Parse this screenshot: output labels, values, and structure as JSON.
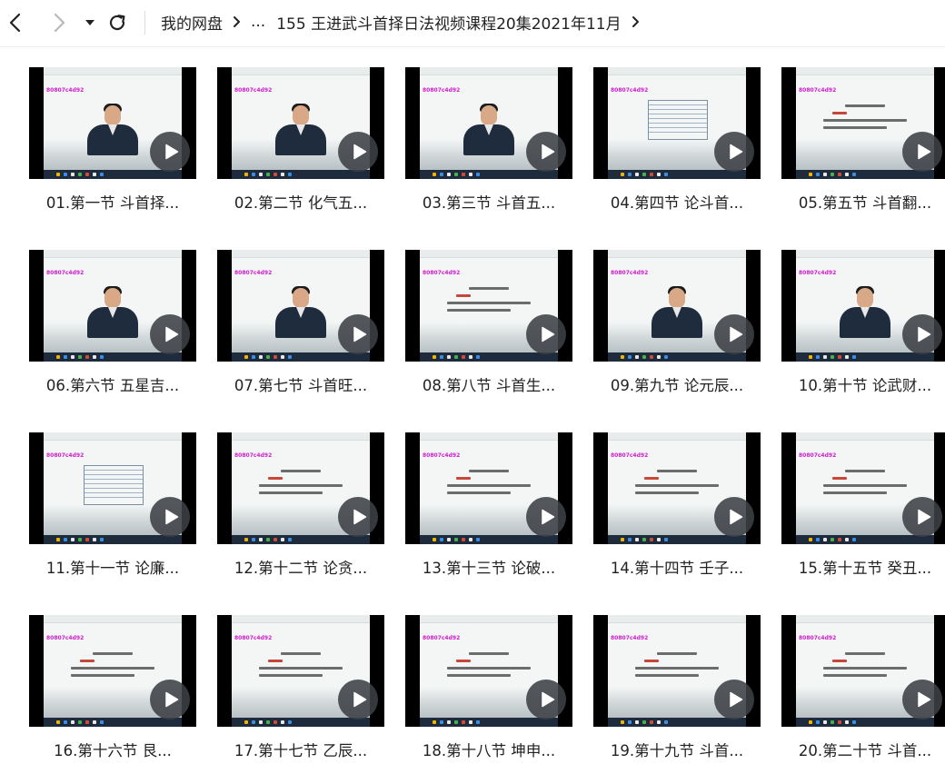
{
  "toolbar": {
    "icons": [
      "back-arrow-icon",
      "forward-arrow-icon",
      "dropdown-triangle-icon",
      "refresh-icon"
    ],
    "breadcrumb": [
      "我的网盘",
      "...",
      "155 王进武斗首择日法视频课程20集2021年11月"
    ]
  },
  "videos": [
    {
      "label": "01.第一节 斗首择...",
      "kind": "person",
      "watermark": "80807c4d92"
    },
    {
      "label": "02.第二节 化气五...",
      "kind": "person",
      "watermark": "80807c4d92"
    },
    {
      "label": "03.第三节 斗首五...",
      "kind": "person",
      "watermark": "80807c4d92"
    },
    {
      "label": "04.第四节 论斗首...",
      "kind": "table",
      "watermark": "80807c4d92"
    },
    {
      "label": "05.第五节 斗首翻...",
      "kind": "slide",
      "watermark": "80807c4d92"
    },
    {
      "label": "06.第六节 五星吉...",
      "kind": "person",
      "watermark": "80807c4d92"
    },
    {
      "label": "07.第七节 斗首旺...",
      "kind": "person",
      "watermark": "80807c4d92"
    },
    {
      "label": "08.第八节 斗首生...",
      "kind": "slide",
      "watermark": "80807c4d92"
    },
    {
      "label": "09.第九节 论元辰...",
      "kind": "person",
      "watermark": "80807c4d92"
    },
    {
      "label": "10.第十节 论武财...",
      "kind": "person",
      "watermark": "80807c4d92"
    },
    {
      "label": "11.第十一节 论廉...",
      "kind": "table",
      "watermark": "80807c4d92"
    },
    {
      "label": "12.第十二节 论贪...",
      "kind": "slide",
      "watermark": "80807c4d92"
    },
    {
      "label": "13.第十三节 论破...",
      "kind": "slide",
      "watermark": "80807c4d92"
    },
    {
      "label": "14.第十四节 壬子...",
      "kind": "slide",
      "watermark": "80807c4d92"
    },
    {
      "label": "15.第十五节 癸丑...",
      "kind": "slide",
      "watermark": "80807c4d92"
    },
    {
      "label": "16.第十六节  艮...",
      "kind": "slide",
      "watermark": "80807c4d92"
    },
    {
      "label": "17.第十七节 乙辰...",
      "kind": "slide",
      "watermark": "80807c4d92"
    },
    {
      "label": "18.第十八节 坤申...",
      "kind": "slide",
      "watermark": "80807c4d92"
    },
    {
      "label": "19.第十九节 斗首...",
      "kind": "slide",
      "watermark": "80807c4d92"
    },
    {
      "label": "20.第二十节 斗首...",
      "kind": "slide",
      "watermark": "80807c4d92"
    }
  ],
  "play_icon": "play-icon"
}
